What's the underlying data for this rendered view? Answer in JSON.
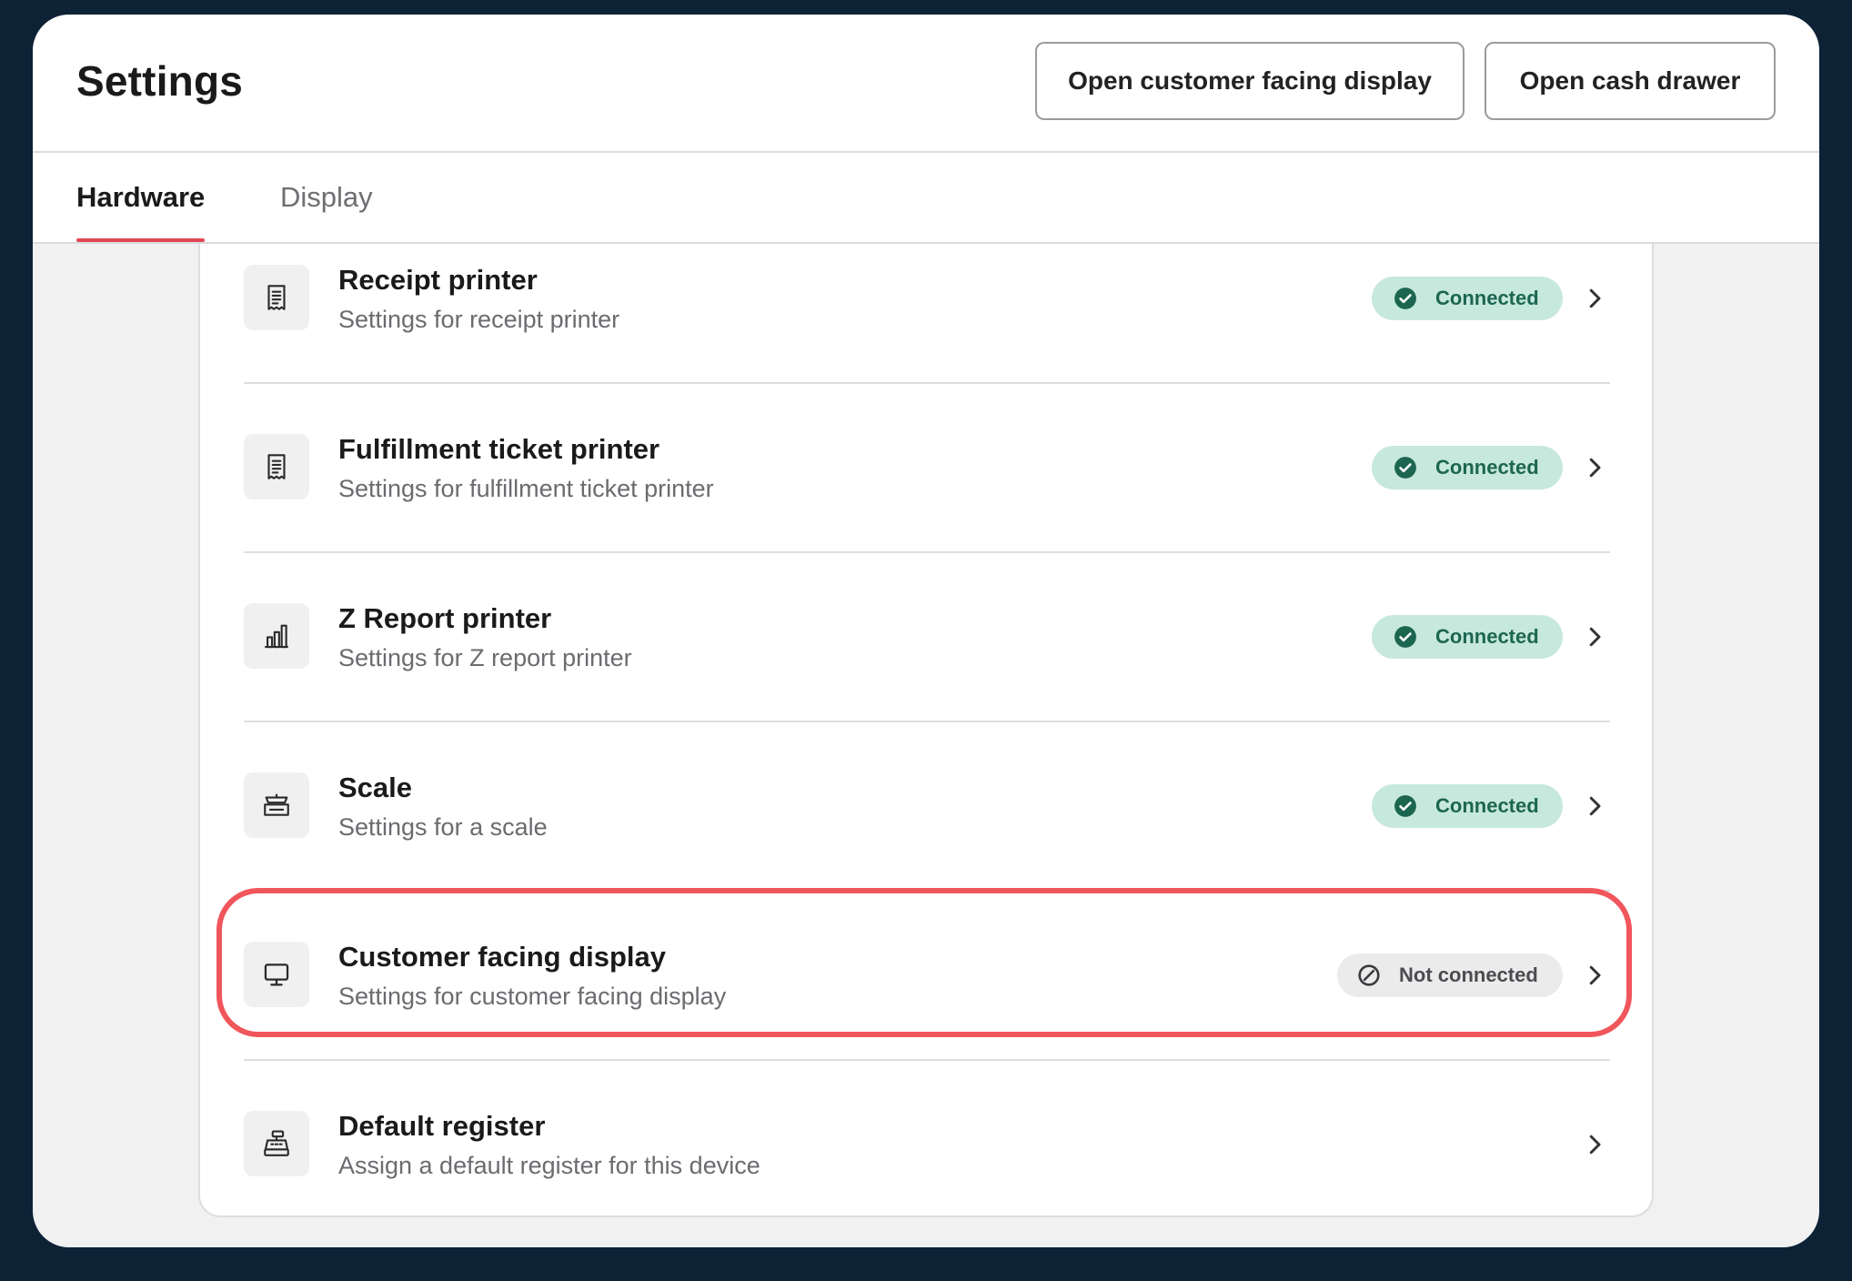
{
  "header": {
    "title": "Settings",
    "buttons": {
      "open_customer_display": "Open customer facing display",
      "open_cash_drawer": "Open cash drawer"
    }
  },
  "tabs": [
    {
      "label": "Hardware",
      "active": true
    },
    {
      "label": "Display",
      "active": false
    }
  ],
  "rows": [
    {
      "title": "Receipt printer",
      "subtitle": "Settings for receipt printer",
      "status": "Connected",
      "icon": "receipt-icon"
    },
    {
      "title": "Fulfillment ticket printer",
      "subtitle": "Settings for fulfillment ticket printer",
      "status": "Connected",
      "icon": "receipt-icon"
    },
    {
      "title": "Z Report printer",
      "subtitle": "Settings for Z report printer",
      "status": "Connected",
      "icon": "bar-chart-icon"
    },
    {
      "title": "Scale",
      "subtitle": "Settings for a scale",
      "status": "Connected",
      "icon": "scale-icon"
    },
    {
      "title": "Customer facing display",
      "subtitle": "Settings for customer facing display",
      "status": "Not connected",
      "icon": "monitor-icon"
    },
    {
      "title": "Default register",
      "subtitle": "Assign a default register for this device",
      "icon": "cash-register-icon"
    }
  ],
  "colors": {
    "accent_tab_underline": "#e04855",
    "connected_bg": "#c7e8dd",
    "connected_fg": "#1c6650",
    "not_connected_bg": "#ebebec",
    "highlight": "#f0565b"
  }
}
